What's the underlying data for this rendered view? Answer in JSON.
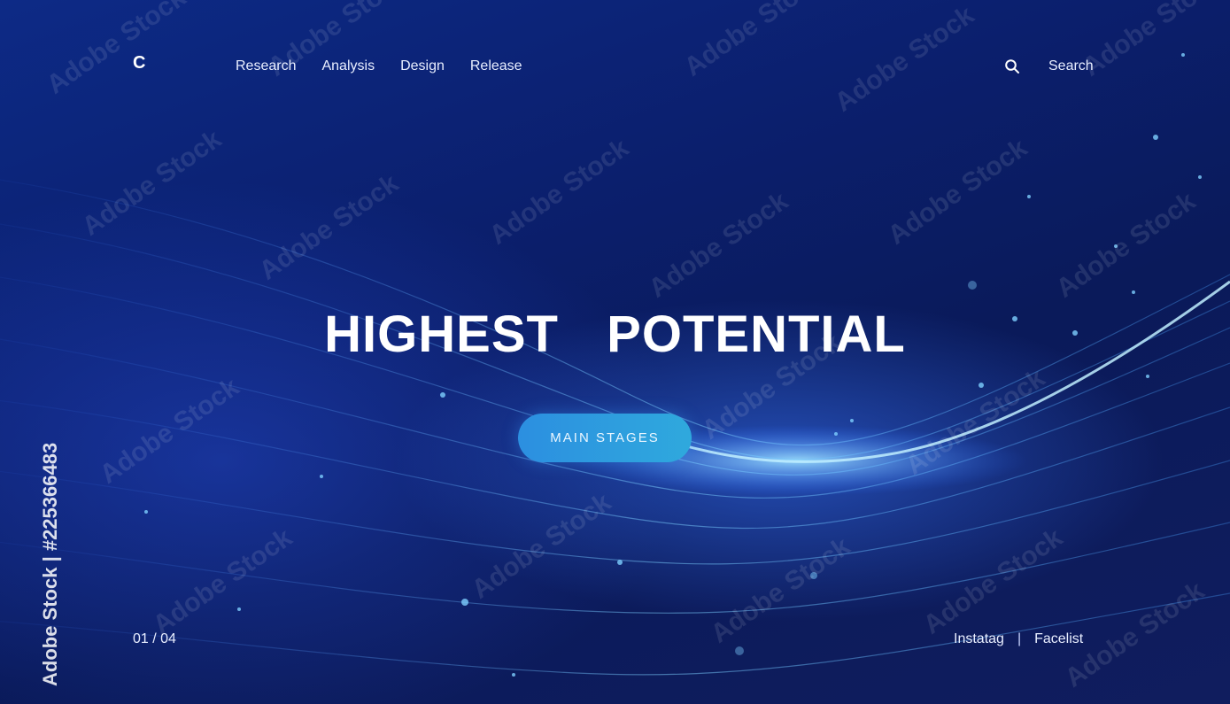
{
  "header": {
    "logo": "C",
    "nav": [
      "Research",
      "Analysis",
      "Design",
      "Release"
    ],
    "search_label": "Search"
  },
  "hero": {
    "title": "HIGHEST  POTENTIAL",
    "button_label": "MAIN STAGES"
  },
  "footer": {
    "pager": "01 / 04",
    "links": [
      "Instatag",
      "Facelist"
    ],
    "separator": "|"
  },
  "stock": {
    "side_credit": "Adobe Stock | #225366483",
    "watermark": "Adobe Stock"
  },
  "colors": {
    "background": "#0b1f6d",
    "accent": "#2fa9dd",
    "text": "#ffffff"
  },
  "icons": {
    "search": "search-icon"
  }
}
